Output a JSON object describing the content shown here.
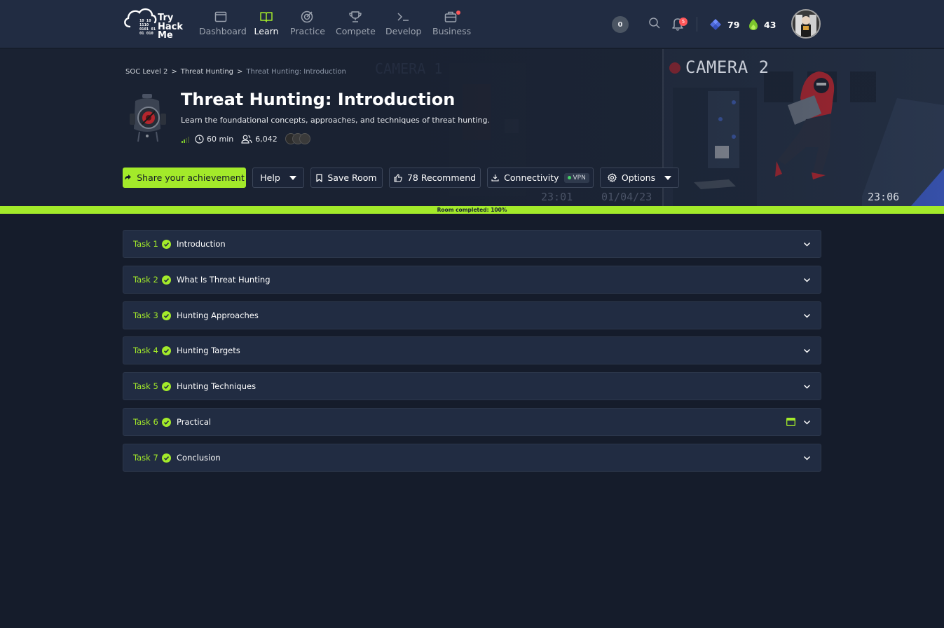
{
  "nav": {
    "logo_text": [
      "Try",
      "Hack",
      "Me"
    ],
    "logo_binary": [
      "10  10",
      "1110",
      "0101 01",
      "01  010"
    ],
    "items": [
      {
        "label": "Dashboard",
        "icon": "dashboard-icon",
        "active": false
      },
      {
        "label": "Learn",
        "icon": "book-icon",
        "active": true
      },
      {
        "label": "Practice",
        "icon": "target-icon",
        "active": false
      },
      {
        "label": "Compete",
        "icon": "trophy-icon",
        "active": false
      },
      {
        "label": "Develop",
        "icon": "terminal-icon",
        "active": false
      },
      {
        "label": "Business",
        "icon": "briefcase-icon",
        "active": false,
        "dot": true
      }
    ],
    "streak_count": "0",
    "notification_count": "5",
    "gems": "79",
    "streak_days": "43"
  },
  "hero": {
    "camera_label": "CAMERA 2",
    "camera_faint_label": "CAMERA 1",
    "timestamp_left": "23:01",
    "date": "01/04/23",
    "timestamp_right": "23:06"
  },
  "room": {
    "breadcrumb": [
      "SOC Level 2",
      "Threat Hunting",
      "Threat Hunting: Introduction"
    ],
    "breadcrumb_sep": ">",
    "title": "Threat Hunting: Introduction",
    "description": "Learn the foundational concepts, approaches, and techniques of threat hunting.",
    "duration": "60 min",
    "users": "6,042"
  },
  "actions": {
    "share": "Share your achievement",
    "help": "Help",
    "save": "Save Room",
    "recommend": "78 Recommend",
    "connectivity": "Connectivity",
    "vpn": "VPN",
    "options": "Options"
  },
  "progress": {
    "label": "Room completed: 100%",
    "percent": 100
  },
  "tasks": [
    {
      "num": "Task 1",
      "title": "Introduction",
      "vm": false
    },
    {
      "num": "Task 2",
      "title": "What Is Threat Hunting",
      "vm": false
    },
    {
      "num": "Task 3",
      "title": "Hunting Approaches",
      "vm": false
    },
    {
      "num": "Task 4",
      "title": "Hunting Targets",
      "vm": false
    },
    {
      "num": "Task 5",
      "title": "Hunting Techniques",
      "vm": false
    },
    {
      "num": "Task 6",
      "title": "Practical",
      "vm": true
    },
    {
      "num": "Task 7",
      "title": "Conclusion",
      "vm": false
    }
  ],
  "colors": {
    "accent": "#a3ea2a",
    "background": "#151c2b",
    "navbar": "#212c42",
    "notification": "#ff575a"
  }
}
